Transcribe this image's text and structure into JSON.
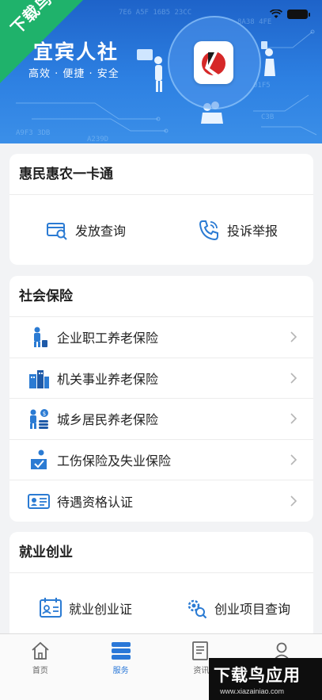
{
  "banner": {
    "title": "宜宾人社",
    "subtitle": "高效 · 便捷 · 安全",
    "watermark_corner": "下载鸟"
  },
  "card_huimin": {
    "title": "惠民惠农一卡通",
    "items": [
      {
        "label": "发放查询",
        "icon": "card-search-icon"
      },
      {
        "label": "投诉举报",
        "icon": "phone-icon"
      }
    ]
  },
  "card_social": {
    "title": "社会保险",
    "items": [
      {
        "label": "企业职工养老保险",
        "icon": "worker-icon"
      },
      {
        "label": "机关事业养老保险",
        "icon": "office-building-icon"
      },
      {
        "label": "城乡居民养老保险",
        "icon": "resident-coin-icon"
      },
      {
        "label": "工伤保险及失业保险",
        "icon": "injury-insurance-icon"
      },
      {
        "label": "待遇资格认证",
        "icon": "id-card-icon"
      }
    ]
  },
  "card_employment": {
    "title": "就业创业",
    "items": [
      {
        "label": "就业创业证",
        "icon": "certificate-icon"
      },
      {
        "label": "创业项目查询",
        "icon": "gear-search-icon"
      }
    ]
  },
  "tabbar": {
    "tabs": [
      {
        "label": "首页",
        "icon": "home-icon",
        "active": false
      },
      {
        "label": "服务",
        "icon": "service-stack-icon",
        "active": true
      },
      {
        "label": "资讯",
        "icon": "news-icon",
        "active": false
      },
      {
        "label": "",
        "icon": "user-icon",
        "active": false
      }
    ]
  },
  "watermark_bottom": {
    "text": "下载鸟应用",
    "url": "www.xiazainiao.com"
  },
  "colors": {
    "accent": "#2a78d8",
    "icon_blue": "#2b7bd3",
    "banner_blue": "#1e63c9",
    "watermark_green": "#1fb26b"
  }
}
